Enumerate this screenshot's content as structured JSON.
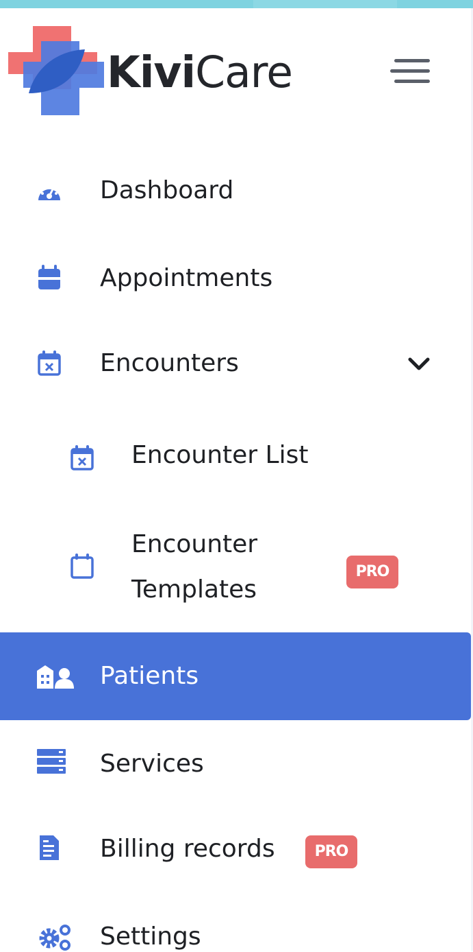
{
  "brand": {
    "name_bold": "Kivi",
    "name_light": "Care",
    "colors": {
      "cross_red": "#f07272",
      "cross_blue": "#4872d8",
      "leaf_blue": "#2f5ec4",
      "active_bg": "#4872d8",
      "icon_blue": "#4872d8",
      "pro_badge": "#e86c6c"
    }
  },
  "header": {
    "menu_icon": "hamburger-icon"
  },
  "nav": {
    "dashboard": {
      "label": "Dashboard",
      "icon": "speedometer-icon"
    },
    "appointments": {
      "label": "Appointments",
      "icon": "calendar-icon"
    },
    "encounters": {
      "label": "Encounters",
      "icon": "calendar-x-icon",
      "expanded": true
    },
    "encounter_list": {
      "label": "Encounter List",
      "icon": "calendar-x-icon"
    },
    "encounter_templates": {
      "label_line1": "Encounter",
      "label_line2": "Templates",
      "icon": "calendar-outline-icon",
      "badge": "PRO"
    },
    "patients": {
      "label": "Patients",
      "icon": "patients-icon",
      "active": true
    },
    "services": {
      "label": "Services",
      "icon": "server-icon"
    },
    "billing_records": {
      "label": "Billing records",
      "icon": "document-icon",
      "badge": "PRO"
    },
    "settings": {
      "label": "Settings",
      "icon": "gears-icon"
    }
  }
}
